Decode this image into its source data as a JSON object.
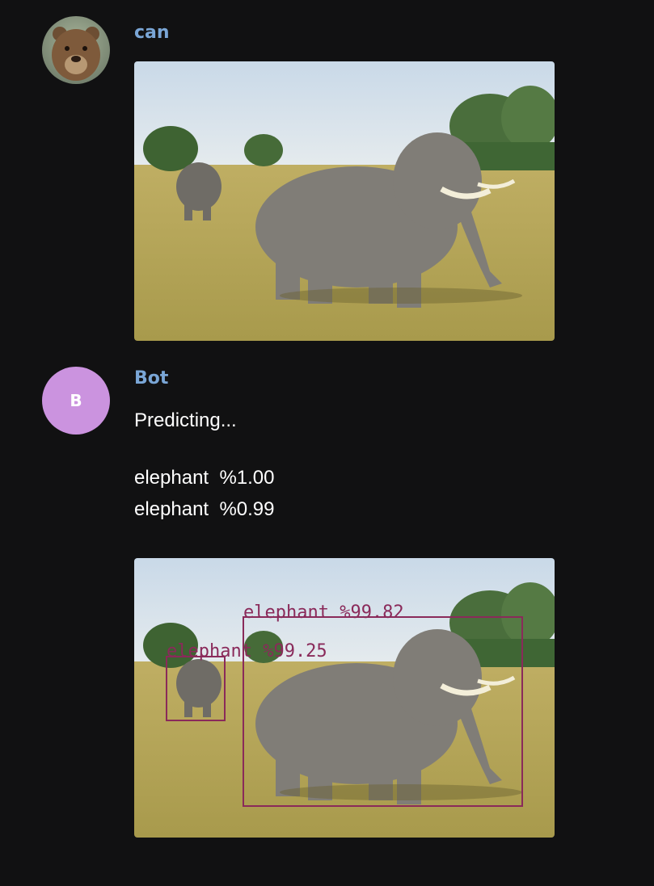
{
  "messages": [
    {
      "author": "can",
      "avatar_icon": "bear-icon",
      "attachment": "elephant-photo"
    },
    {
      "author": "Bot",
      "avatar_initial": "B",
      "avatar_color": "#cb93df",
      "status_text": "Predicting...",
      "predictions": [
        {
          "label": "elephant",
          "score_text": "%1.00"
        },
        {
          "label": "elephant",
          "score_text": "%0.99"
        }
      ],
      "annotated_attachment": {
        "detections": [
          {
            "text": "elephant %99.82"
          },
          {
            "text": "elephant %99.25"
          }
        ],
        "box_color": "#8a2a5a"
      }
    }
  ],
  "theme": {
    "background": "#111112",
    "username_color": "#7aa6d6",
    "text_color": "#ffffff"
  }
}
